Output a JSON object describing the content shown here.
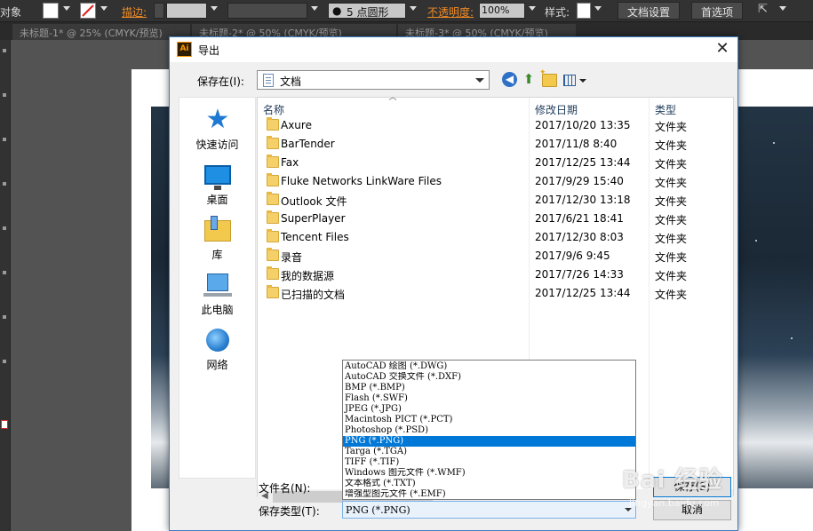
{
  "toolbar": {
    "object_label": "对象",
    "stroke_label": "描边:",
    "brush_value": "5 点圆形",
    "opacity_label": "不透明度:",
    "opacity_value": "100%",
    "style_label": "样式:",
    "document_setup": "文档设置",
    "preferences": "首选项"
  },
  "doc_tabs": [
    "未标题-1* @ 25% (CMYK/预览)",
    "未标题-2* @ 50% (CMYK/预览)",
    "未标题-3* @ 50% (CMYK/预览)"
  ],
  "dialog": {
    "title": "导出",
    "save_in_label": "保存在(I):",
    "save_in_value": "文档",
    "places": [
      "快速访问",
      "桌面",
      "库",
      "此电脑",
      "网络"
    ],
    "columns": {
      "name": "名称",
      "date": "修改日期",
      "type": "类型"
    },
    "files": [
      {
        "name": "Axure",
        "date": "2017/10/20 13:35",
        "type": "文件夹"
      },
      {
        "name": "BarTender",
        "date": "2017/11/8 8:40",
        "type": "文件夹"
      },
      {
        "name": "Fax",
        "date": "2017/12/25 13:44",
        "type": "文件夹"
      },
      {
        "name": "Fluke Networks LinkWare Files",
        "date": "2017/9/29 15:40",
        "type": "文件夹"
      },
      {
        "name": "Outlook 文件",
        "date": "2017/12/30 13:18",
        "type": "文件夹"
      },
      {
        "name": "SuperPlayer",
        "date": "2017/6/21 18:41",
        "type": "文件夹"
      },
      {
        "name": "Tencent Files",
        "date": "2017/12/30 8:03",
        "type": "文件夹"
      },
      {
        "name": "录音",
        "date": "2017/9/6 9:45",
        "type": "文件夹"
      },
      {
        "name": "我的数据源",
        "date": "2017/7/26 14:33",
        "type": "文件夹"
      },
      {
        "name": "已扫描的文档",
        "date": "2017/12/25 13:44",
        "type": "文件夹"
      }
    ],
    "file_name_label": "文件名(N):",
    "save_type_label": "保存类型(T):",
    "save_type_value": "PNG (*.PNG)",
    "save_button": "保存(S)",
    "cancel_button": "取消",
    "type_options": [
      "AutoCAD 绘图 (*.DWG)",
      "AutoCAD 交换文件 (*.DXF)",
      "BMP (*.BMP)",
      "Flash (*.SWF)",
      "JPEG (*.JPG)",
      "Macintosh PICT (*.PCT)",
      "Photoshop (*.PSD)",
      "PNG (*.PNG)",
      "Targa (*.TGA)",
      "TIFF (*.TIF)",
      "Windows 图元文件 (*.WMF)",
      "文本格式 (*.TXT)",
      "增强型图元文件 (*.EMF)"
    ],
    "selected_option_index": 7
  },
  "watermark": {
    "text": "Bai 经验",
    "sub": "jingyan.baidu.com"
  },
  "colors": {
    "accent": "#0078d7",
    "illustrator_orange": "#f08a24",
    "chrome": "#323232"
  }
}
